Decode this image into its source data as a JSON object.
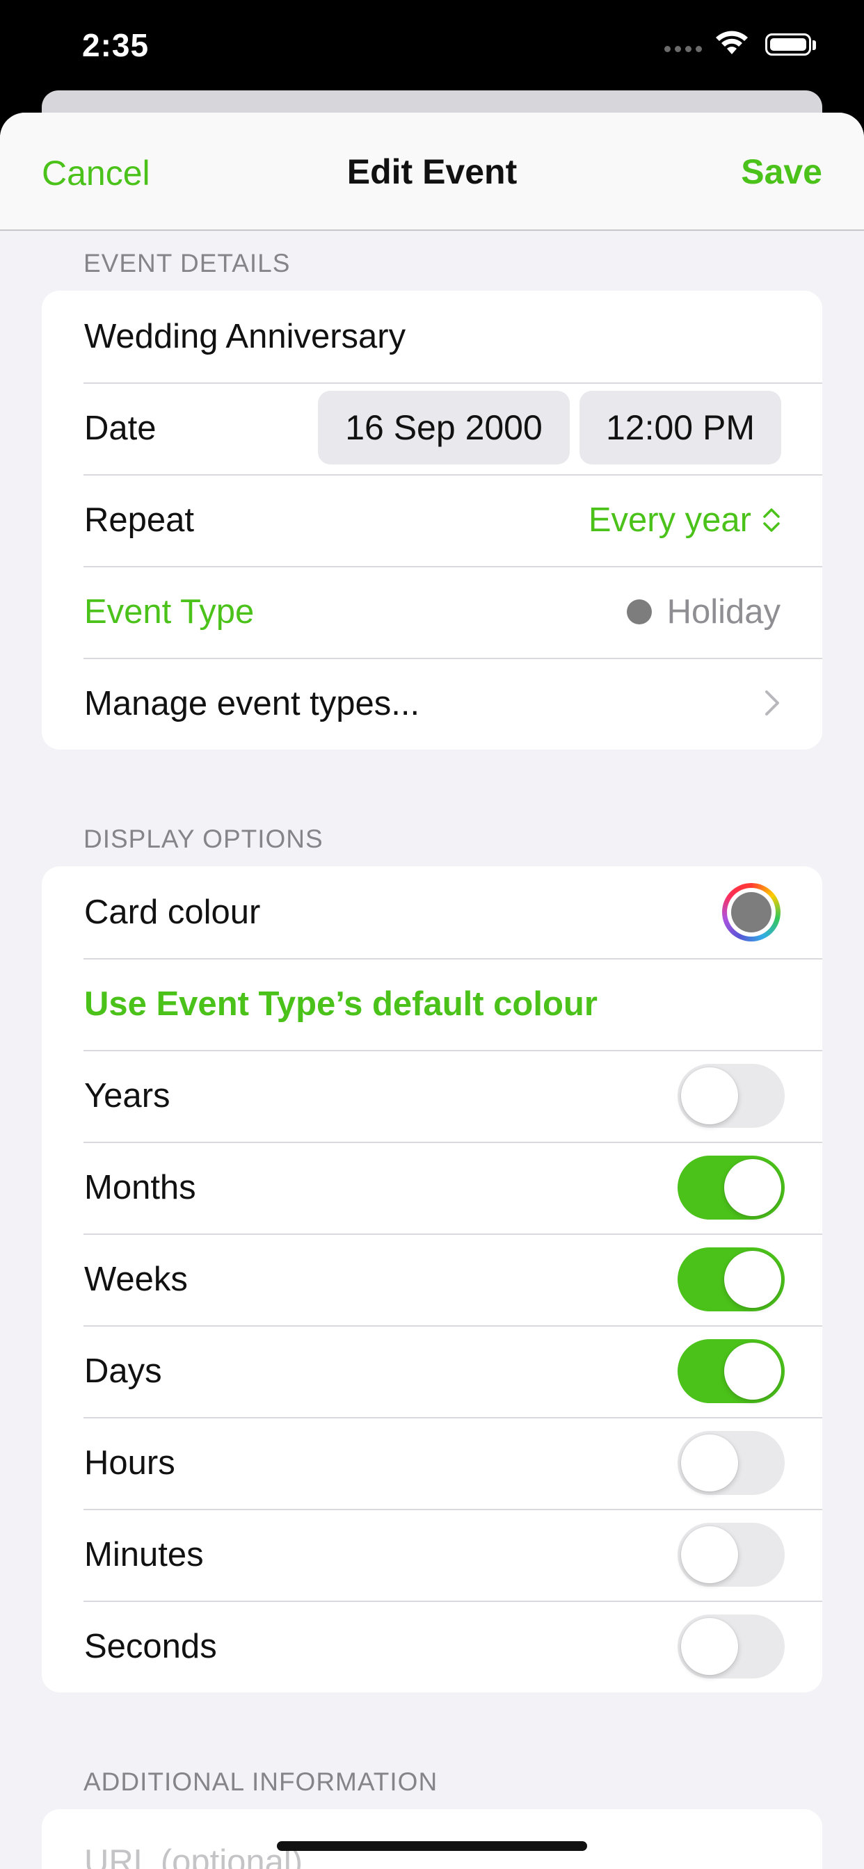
{
  "status_bar": {
    "time": "2:35"
  },
  "nav": {
    "cancel_label": "Cancel",
    "title": "Edit Event",
    "save_label": "Save"
  },
  "event_details": {
    "header": "EVENT DETAILS",
    "name_value": "Wedding Anniversary",
    "date_label": "Date",
    "date_value": "16 Sep 2000",
    "time_value": "12:00 PM",
    "repeat_label": "Repeat",
    "repeat_value": "Every year",
    "event_type_label": "Event Type",
    "event_type_value": "Holiday",
    "event_type_color": "#7d7d7d",
    "manage_label": "Manage event types..."
  },
  "display_options": {
    "header": "DISPLAY OPTIONS",
    "card_colour_label": "Card colour",
    "card_colour_value": "#7d7d7d",
    "use_default_label": "Use Event Type’s default colour",
    "toggles": [
      {
        "label": "Years",
        "on": false
      },
      {
        "label": "Months",
        "on": true
      },
      {
        "label": "Weeks",
        "on": true
      },
      {
        "label": "Days",
        "on": true
      },
      {
        "label": "Hours",
        "on": false
      },
      {
        "label": "Minutes",
        "on": false
      },
      {
        "label": "Seconds",
        "on": false
      }
    ]
  },
  "additional_info": {
    "header": "ADDITIONAL INFORMATION",
    "url_placeholder": "URL (optional)"
  },
  "colors": {
    "accent": "#4bc21a",
    "background": "#f2f2f7"
  }
}
